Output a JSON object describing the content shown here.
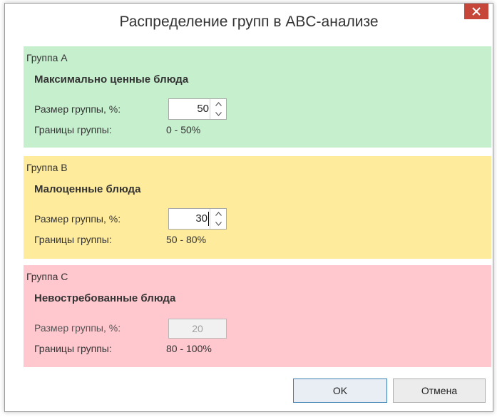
{
  "dialog": {
    "title": "Распределение групп в ABC-анализе",
    "close_icon": "close-icon"
  },
  "colors": {
    "group_a": "#c6efce",
    "group_b": "#ffeb9c",
    "group_c": "#ffc7ce",
    "close_button": "#c7463a"
  },
  "groups": [
    {
      "header": "Группа А",
      "description": "Максимально ценные блюда",
      "size_label": "Размер группы, %:",
      "size_value": "50",
      "bounds_label": "Границы группы:",
      "bounds_value": "0 - 50%"
    },
    {
      "header": "Группа В",
      "description": "Малоценные блюда",
      "size_label": "Размер группы, %:",
      "size_value": "30",
      "bounds_label": "Границы группы:",
      "bounds_value": "50 - 80%"
    },
    {
      "header": "Группа С",
      "description": "Невостребованные блюда",
      "size_label": "Размер группы, %:",
      "size_value": "20",
      "bounds_label": "Границы группы:",
      "bounds_value": "80 - 100%"
    }
  ],
  "buttons": {
    "ok": "OK",
    "cancel": "Отмена"
  }
}
